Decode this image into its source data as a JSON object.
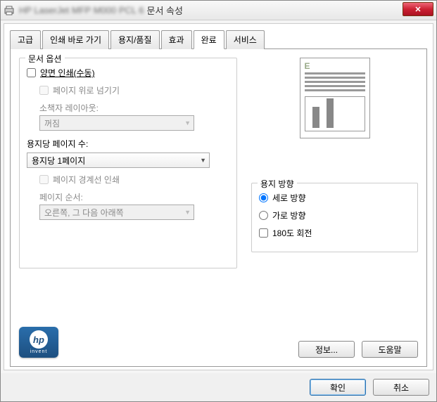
{
  "window": {
    "title_suffix": " 문서 속성",
    "close_label": "✕"
  },
  "tabs": {
    "items": [
      {
        "label": "고급"
      },
      {
        "label": "인쇄 바로 가기"
      },
      {
        "label": "용지/품질"
      },
      {
        "label": "효과"
      },
      {
        "label": "완료"
      },
      {
        "label": "서비스"
      }
    ],
    "active_index": 4
  },
  "doc_options": {
    "group_title": "문서 옵션",
    "duplex": {
      "label": "양면 인쇄(수동)",
      "checked": false
    },
    "flip_up": {
      "label": "페이지 위로 넘기기",
      "checked": false,
      "enabled": false
    },
    "booklet": {
      "label": "소책자 레이아웃:",
      "value": "꺼짐",
      "enabled": false
    },
    "pages_per_sheet": {
      "label": "용지당 페이지 수:",
      "value": "용지당 1페이지",
      "enabled": true
    },
    "page_borders": {
      "label": "페이지 경계선 인쇄",
      "checked": false,
      "enabled": false
    },
    "page_order": {
      "label": "페이지 순서:",
      "value": "오른쪽, 그 다음 아래쪽",
      "enabled": false
    }
  },
  "preview": {
    "letter": "E"
  },
  "orientation": {
    "group_title": "용지 방향",
    "portrait": {
      "label": "세로 방향",
      "checked": true
    },
    "landscape": {
      "label": "가로 방향",
      "checked": false
    },
    "rotate180": {
      "label": "180도 회전",
      "checked": false
    }
  },
  "logo": {
    "brand": "hp",
    "tagline": "invent"
  },
  "panel_buttons": {
    "about": "정보...",
    "help": "도움말"
  },
  "bottom_buttons": {
    "ok": "확인",
    "cancel": "취소"
  }
}
